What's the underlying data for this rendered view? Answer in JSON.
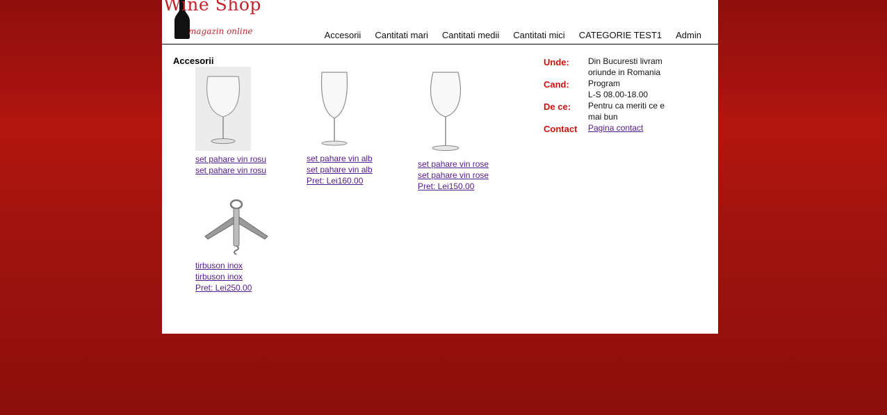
{
  "logo": {
    "title": "Wine Shop",
    "subtitle": "magazin online"
  },
  "nav": [
    "Accesorii",
    "Cantitati mari",
    "Cantitati medii",
    "Cantitati mici",
    "CATEGORIE TEST1",
    "Admin"
  ],
  "section_title": "Accesorii",
  "products": [
    {
      "name": "set pahare vin rosu",
      "name2": "set pahare vin rosu",
      "price": "",
      "image": "wine-glass-icon"
    },
    {
      "name": "set pahare vin alb",
      "name2": "set pahare vin alb",
      "price": "Pret: Lei160.00",
      "image": "wine-glass-icon"
    },
    {
      "name": "set pahare vin rose",
      "name2": "set pahare vin rose",
      "price": "Pret: Lei150.00",
      "image": "wine-glass-icon"
    },
    {
      "name": "tirbuson inox",
      "name2": "tirbuson inox",
      "price": "Pret: Lei250.00",
      "image": "corkscrew-icon"
    }
  ],
  "info": {
    "unde_label": "Unde:",
    "unde_value": "Din Bucuresti livram oriunde in Romania",
    "cand_label": "Cand:",
    "cand_value1": "Program",
    "cand_value2": "L-S 08.00-18.00",
    "dece_label": "De ce:",
    "dece_value": "Pentru ca meriti ce e mai bun",
    "contact_label": "Contact",
    "contact_link": "Pagina contact"
  },
  "colors": {
    "brand": "#c0242c",
    "background": "#a7130f",
    "link": "#551a8b",
    "accent_red": "#cc1111"
  }
}
